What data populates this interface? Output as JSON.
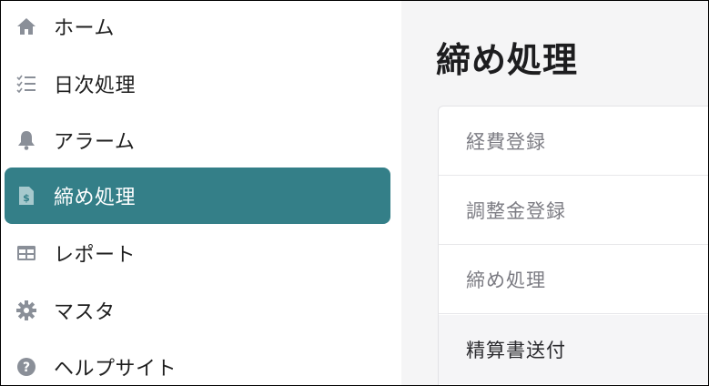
{
  "sidebar": {
    "items": [
      {
        "label": "ホーム",
        "icon": "home-icon"
      },
      {
        "label": "日次処理",
        "icon": "checklist-icon"
      },
      {
        "label": "アラーム",
        "icon": "bell-icon"
      },
      {
        "label": "締め処理",
        "icon": "invoice-icon",
        "active": true
      },
      {
        "label": "レポート",
        "icon": "table-icon"
      },
      {
        "label": "マスタ",
        "icon": "gear-icon"
      },
      {
        "label": "ヘルプサイト",
        "icon": "help-icon"
      }
    ]
  },
  "main": {
    "title": "締め処理",
    "menu": [
      {
        "label": "経費登録"
      },
      {
        "label": "調整金登録"
      },
      {
        "label": "締め処理"
      },
      {
        "label": "精算書送付",
        "selected": true
      }
    ]
  },
  "colors": {
    "active_bg": "#347f88",
    "icon_gray": "#8a8f98",
    "main_bg": "#f5f5f6"
  }
}
